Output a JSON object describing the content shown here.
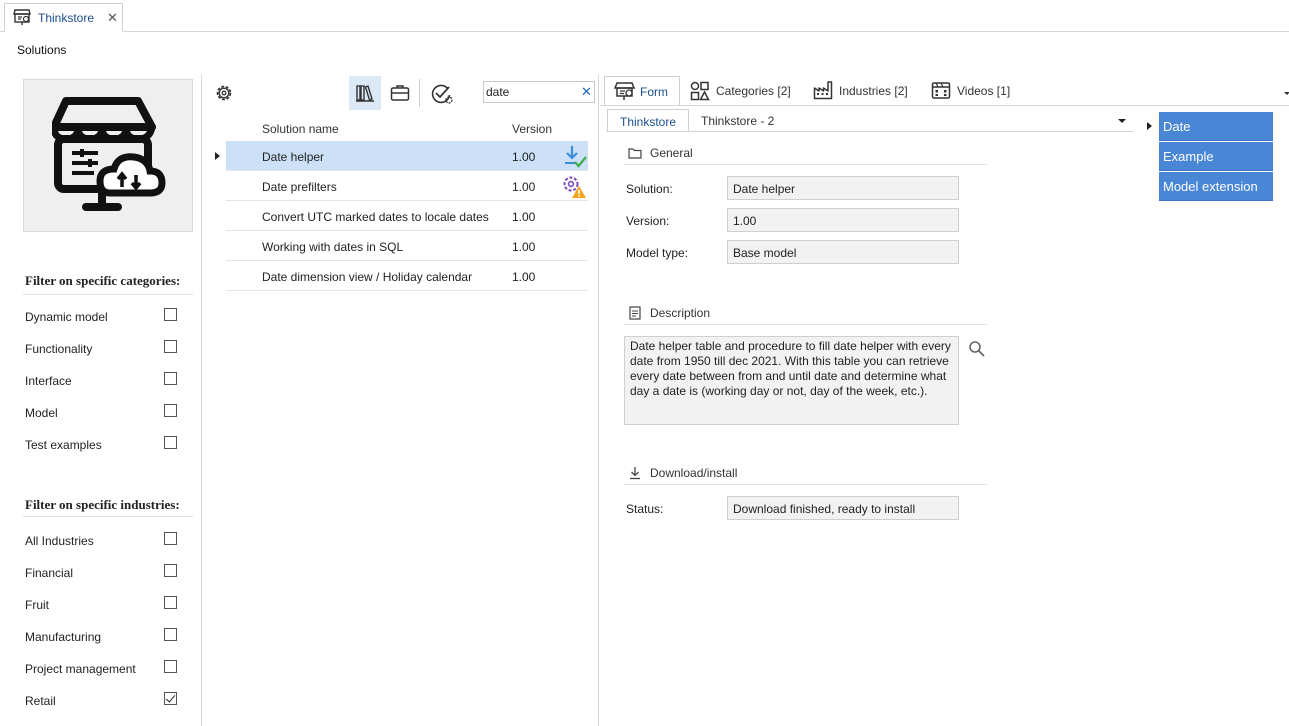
{
  "window": {
    "tab_title": "Thinkstore",
    "close_glyph": "✕"
  },
  "page_title": "Solutions",
  "filters": {
    "categories_title": "Filter on specific categories:",
    "categories": [
      {
        "label": "Dynamic model",
        "checked": false
      },
      {
        "label": "Functionality",
        "checked": false
      },
      {
        "label": "Interface",
        "checked": false
      },
      {
        "label": "Model",
        "checked": false
      },
      {
        "label": "Test examples",
        "checked": false
      }
    ],
    "industries_title": "Filter on specific industries:",
    "industries": [
      {
        "label": "All Industries",
        "checked": false
      },
      {
        "label": "Financial",
        "checked": false
      },
      {
        "label": "Fruit",
        "checked": false
      },
      {
        "label": "Manufacturing",
        "checked": false
      },
      {
        "label": "Project management",
        "checked": false
      },
      {
        "label": "Retail",
        "checked": true
      }
    ]
  },
  "toolbar": {
    "icons": [
      "settings-gear-icon",
      "library-books-icon",
      "briefcase-icon",
      "check-gear-icon"
    ],
    "search": {
      "value": "date",
      "clear_glyph": "✕"
    }
  },
  "grid": {
    "columns": {
      "name": "Solution name",
      "version": "Version"
    },
    "rows": [
      {
        "name": "Date helper",
        "version": "1.00",
        "status_icon": "download-check-icon",
        "selected": true
      },
      {
        "name": "Date prefilters",
        "version": "1.00",
        "status_icon": "gear-warning-icon",
        "selected": false
      },
      {
        "name": "Convert UTC marked dates to locale dates",
        "version": "1.00",
        "status_icon": "",
        "selected": false
      },
      {
        "name": "Working with dates in SQL",
        "version": "1.00",
        "status_icon": "",
        "selected": false
      },
      {
        "name": "Date dimension view / Holiday calendar",
        "version": "1.00",
        "status_icon": "",
        "selected": false
      }
    ]
  },
  "detail_tabs": [
    {
      "label": "Form",
      "icon": "store-icon"
    },
    {
      "label": "Categories [2]",
      "icon": "shapes-icon"
    },
    {
      "label": "Industries [2]",
      "icon": "factory-icon"
    },
    {
      "label": "Videos [1]",
      "icon": "video-icon"
    }
  ],
  "sub_tabs": [
    "Thinkstore",
    "Thinkstore - 2"
  ],
  "form": {
    "general": {
      "title": "General",
      "solution_label": "Solution:",
      "solution_value": "Date helper",
      "version_label": "Version:",
      "version_value": "1.00",
      "model_type_label": "Model type:",
      "model_type_value": "Base model"
    },
    "description": {
      "title": "Description",
      "text": "Date helper table and procedure to fill date helper with every date from 1950 till dec 2021. With this table you can retrieve every date between from and until date and determine what day a date is (working day or not, day of the week, etc.)."
    },
    "download": {
      "title": "Download/install",
      "status_label": "Status:",
      "status_value": "Download finished, ready to install"
    }
  },
  "category_list": [
    "Date",
    "Example",
    "Model extension"
  ],
  "colors": {
    "accent": "#4a86d6",
    "selection": "#cce0f7",
    "link": "#1c4f8c"
  }
}
